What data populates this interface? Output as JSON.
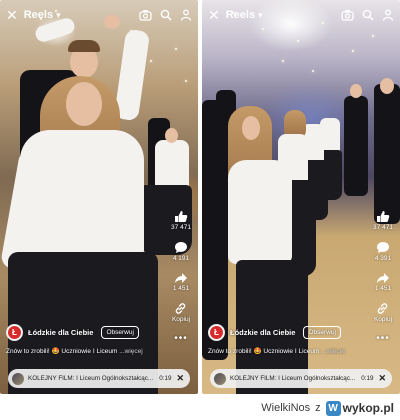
{
  "screens": [
    {
      "header": {
        "title": "Reels"
      },
      "rail": {
        "likes": "37 471",
        "comments": "4 191",
        "shares": "1 451",
        "copy_label": "Kopiuj"
      },
      "account": {
        "avatar_letter": "Ł",
        "name": "Łódzkie dla Ciebie",
        "follow_label": "Obserwuj"
      },
      "caption": {
        "text": "Znów to zrobili! 🤩 Uczniowie I Liceum",
        "more": "...więcej"
      },
      "banner": {
        "text": "KOLEJNY FILM: I Liceum Ogólnokształcąc...",
        "time": "0:19"
      }
    },
    {
      "header": {
        "title": "Reels"
      },
      "rail": {
        "likes": "37 471",
        "comments": "4 391",
        "shares": "1 451",
        "copy_label": "Kopiuj"
      },
      "account": {
        "avatar_letter": "Ł",
        "name": "Łódzkie dla Ciebie",
        "follow_label": "Obserwuj"
      },
      "caption": {
        "text": "Znów to zrobili! 🤩 Uczniowie I Liceum",
        "more": "...więcej"
      },
      "banner": {
        "text": "KOLEJNY FILM: I Liceum Ogólnokształcąc...",
        "time": "0:19"
      }
    }
  ],
  "footer": {
    "username": "WielkiNos",
    "separator": "z",
    "site_badge": "W",
    "site_name": "wykop.pl"
  },
  "icons": {
    "back": "close-icon",
    "header": [
      "camera-icon",
      "search-icon",
      "profile-icon"
    ],
    "rail": [
      "thumbs-up-icon",
      "comment-icon",
      "share-icon",
      "link-icon",
      "more-icon"
    ]
  }
}
